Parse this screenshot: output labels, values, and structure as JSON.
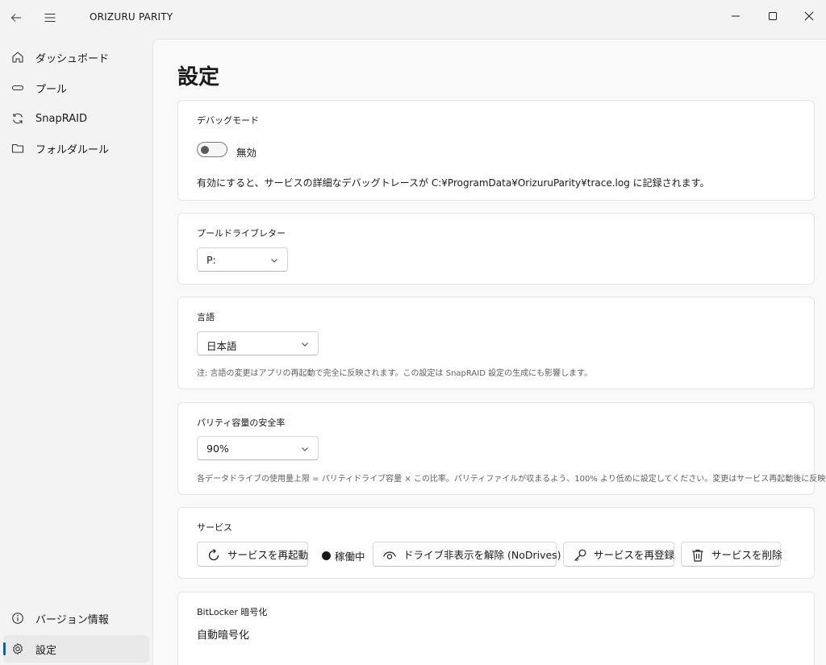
{
  "app": {
    "title": "ORIZURU PARITY"
  },
  "nav": {
    "items": [
      {
        "label": "ダッシュボード",
        "icon": "home-icon"
      },
      {
        "label": "プール",
        "icon": "drive-icon"
      },
      {
        "label": "SnapRAID",
        "icon": "sync-icon"
      },
      {
        "label": "フォルダルール",
        "icon": "folder-icon"
      }
    ],
    "footer": [
      {
        "label": "バージョン情報",
        "icon": "info-icon"
      },
      {
        "label": "設定",
        "icon": "gear-icon",
        "selected": true
      }
    ]
  },
  "page": {
    "title": "設定"
  },
  "debug": {
    "title": "デバッグモード",
    "toggle_state": "無効",
    "enabled": false,
    "description": "有効にすると、サービスの詳細なデバッグトレースが C:¥ProgramData¥OrizuruParity¥trace.log に記録されます。"
  },
  "pool_letter": {
    "title": "プールドライブレター",
    "value": "P:"
  },
  "language": {
    "title": "言語",
    "value": "日本語",
    "note": "注: 言語の変更はアプリの再起動で完全に反映されます。この設定は SnapRAID 設定の生成にも影響します。"
  },
  "parity": {
    "title": "パリティ容量の安全率",
    "value": "90%",
    "note": "各データドライブの使用量上限 = パリティドライブ容量 × この比率。パリティファイルが収まるよう、100% より低めに設定してください。変更はサービス再起動後に反映されます。"
  },
  "service": {
    "title": "サービス",
    "restart_label": "サービスを再起動",
    "status_label": "稼働中",
    "unhide_label": "ドライブ非表示を解除 (NoDrives)",
    "reregister_label": "サービスを再登録",
    "delete_label": "サービスを削除"
  },
  "bitlocker": {
    "title": "BitLocker 暗号化",
    "subtitle": "自動暗号化"
  },
  "colors": {
    "accent": "#005fb8",
    "window_bg": "#f3f3f3",
    "card_bg": "#ffffff"
  }
}
